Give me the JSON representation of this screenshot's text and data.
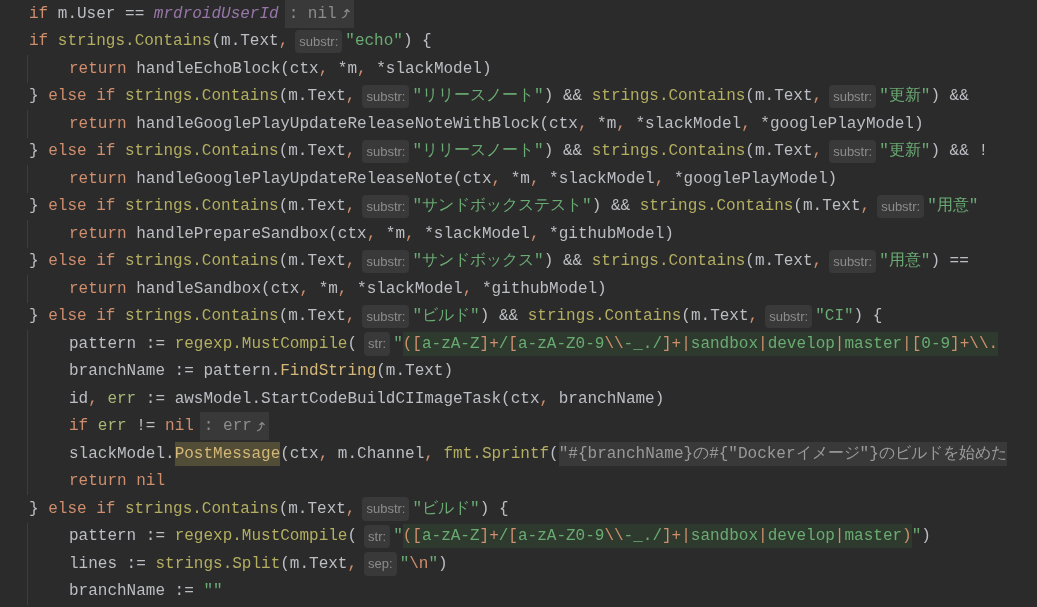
{
  "editor": {
    "lines": [
      {
        "indented": false,
        "tokens": [
          {
            "kind": "kw",
            "text": "if "
          },
          {
            "kind": "plain",
            "text": "m.User == "
          },
          {
            "kind": "const",
            "text": "mrdroidUserId"
          },
          {
            "kind": "endhint",
            "text": ": nil"
          }
        ]
      },
      {
        "indented": false,
        "tokens": [
          {
            "kind": "kw",
            "text": "if "
          },
          {
            "kind": "pkg",
            "text": "strings.Contains"
          },
          {
            "kind": "plain",
            "text": "(m.Text"
          },
          {
            "kind": "punct",
            "text": ","
          },
          {
            "kind": "hint",
            "text": "substr:"
          },
          {
            "kind": "str",
            "text": "\"echo\""
          },
          {
            "kind": "plain",
            "text": ") {"
          }
        ]
      },
      {
        "indented": true,
        "tokens": [
          {
            "kind": "kw",
            "text": "return "
          },
          {
            "kind": "plain",
            "text": "handleEchoBlock(ctx"
          },
          {
            "kind": "punct",
            "text": ", "
          },
          {
            "kind": "plain",
            "text": "*m"
          },
          {
            "kind": "punct",
            "text": ", "
          },
          {
            "kind": "plain",
            "text": "*slackModel)"
          }
        ]
      },
      {
        "indented": false,
        "tokens": [
          {
            "kind": "plain",
            "text": "} "
          },
          {
            "kind": "kw",
            "text": "else if "
          },
          {
            "kind": "pkg",
            "text": "strings.Contains"
          },
          {
            "kind": "plain",
            "text": "(m.Text"
          },
          {
            "kind": "punct",
            "text": ","
          },
          {
            "kind": "hint",
            "text": "substr:"
          },
          {
            "kind": "str",
            "text": "\"リリースノート\""
          },
          {
            "kind": "plain",
            "text": ") && "
          },
          {
            "kind": "pkg",
            "text": "strings.Contains"
          },
          {
            "kind": "plain",
            "text": "(m.Text"
          },
          {
            "kind": "punct",
            "text": ","
          },
          {
            "kind": "hint",
            "text": "substr:"
          },
          {
            "kind": "str",
            "text": "\"更新\""
          },
          {
            "kind": "plain",
            "text": ") &&"
          }
        ]
      },
      {
        "indented": true,
        "tokens": [
          {
            "kind": "kw",
            "text": "return "
          },
          {
            "kind": "plain",
            "text": "handleGooglePlayUpdateReleaseNoteWithBlock(ctx"
          },
          {
            "kind": "punct",
            "text": ", "
          },
          {
            "kind": "plain",
            "text": "*m"
          },
          {
            "kind": "punct",
            "text": ", "
          },
          {
            "kind": "plain",
            "text": "*slackModel"
          },
          {
            "kind": "punct",
            "text": ", "
          },
          {
            "kind": "plain",
            "text": "*googlePlayModel)"
          }
        ]
      },
      {
        "indented": false,
        "tokens": [
          {
            "kind": "plain",
            "text": "} "
          },
          {
            "kind": "kw",
            "text": "else if "
          },
          {
            "kind": "pkg",
            "text": "strings.Contains"
          },
          {
            "kind": "plain",
            "text": "(m.Text"
          },
          {
            "kind": "punct",
            "text": ","
          },
          {
            "kind": "hint",
            "text": "substr:"
          },
          {
            "kind": "str",
            "text": "\"リリースノート\""
          },
          {
            "kind": "plain",
            "text": ") && "
          },
          {
            "kind": "pkg",
            "text": "strings.Contains"
          },
          {
            "kind": "plain",
            "text": "(m.Text"
          },
          {
            "kind": "punct",
            "text": ","
          },
          {
            "kind": "hint",
            "text": "substr:"
          },
          {
            "kind": "str",
            "text": "\"更新\""
          },
          {
            "kind": "plain",
            "text": ") && !"
          }
        ]
      },
      {
        "indented": true,
        "tokens": [
          {
            "kind": "kw",
            "text": "return "
          },
          {
            "kind": "plain",
            "text": "handleGooglePlayUpdateReleaseNote(ctx"
          },
          {
            "kind": "punct",
            "text": ", "
          },
          {
            "kind": "plain",
            "text": "*m"
          },
          {
            "kind": "punct",
            "text": ", "
          },
          {
            "kind": "plain",
            "text": "*slackModel"
          },
          {
            "kind": "punct",
            "text": ", "
          },
          {
            "kind": "plain",
            "text": "*googlePlayModel)"
          }
        ]
      },
      {
        "indented": false,
        "tokens": [
          {
            "kind": "plain",
            "text": "} "
          },
          {
            "kind": "kw",
            "text": "else if "
          },
          {
            "kind": "pkg",
            "text": "strings.Contains"
          },
          {
            "kind": "plain",
            "text": "(m.Text"
          },
          {
            "kind": "punct",
            "text": ","
          },
          {
            "kind": "hint",
            "text": "substr:"
          },
          {
            "kind": "str",
            "text": "\"サンドボックステスト\""
          },
          {
            "kind": "plain",
            "text": ") && "
          },
          {
            "kind": "pkg",
            "text": "strings.Contains"
          },
          {
            "kind": "plain",
            "text": "(m.Text"
          },
          {
            "kind": "punct",
            "text": ","
          },
          {
            "kind": "hint",
            "text": "substr:"
          },
          {
            "kind": "str",
            "text": "\"用意\""
          }
        ]
      },
      {
        "indented": true,
        "tokens": [
          {
            "kind": "kw",
            "text": "return "
          },
          {
            "kind": "plain",
            "text": "handlePrepareSandbox(ctx"
          },
          {
            "kind": "punct",
            "text": ", "
          },
          {
            "kind": "plain",
            "text": "*m"
          },
          {
            "kind": "punct",
            "text": ", "
          },
          {
            "kind": "plain",
            "text": "*slackModel"
          },
          {
            "kind": "punct",
            "text": ", "
          },
          {
            "kind": "plain",
            "text": "*githubModel)"
          }
        ]
      },
      {
        "indented": false,
        "tokens": [
          {
            "kind": "plain",
            "text": "} "
          },
          {
            "kind": "kw",
            "text": "else if "
          },
          {
            "kind": "pkg",
            "text": "strings.Contains"
          },
          {
            "kind": "plain",
            "text": "(m.Text"
          },
          {
            "kind": "punct",
            "text": ","
          },
          {
            "kind": "hint",
            "text": "substr:"
          },
          {
            "kind": "str",
            "text": "\"サンドボックス\""
          },
          {
            "kind": "plain",
            "text": ") && "
          },
          {
            "kind": "pkg",
            "text": "strings.Contains"
          },
          {
            "kind": "plain",
            "text": "(m.Text"
          },
          {
            "kind": "punct",
            "text": ","
          },
          {
            "kind": "hint",
            "text": "substr:"
          },
          {
            "kind": "str",
            "text": "\"用意\""
          },
          {
            "kind": "plain",
            "text": ") =="
          }
        ]
      },
      {
        "indented": true,
        "tokens": [
          {
            "kind": "kw",
            "text": "return "
          },
          {
            "kind": "plain",
            "text": "handleSandbox(ctx"
          },
          {
            "kind": "punct",
            "text": ", "
          },
          {
            "kind": "plain",
            "text": "*m"
          },
          {
            "kind": "punct",
            "text": ", "
          },
          {
            "kind": "plain",
            "text": "*slackModel"
          },
          {
            "kind": "punct",
            "text": ", "
          },
          {
            "kind": "plain",
            "text": "*githubModel)"
          }
        ]
      },
      {
        "indented": false,
        "tokens": [
          {
            "kind": "plain",
            "text": "} "
          },
          {
            "kind": "kw",
            "text": "else if "
          },
          {
            "kind": "pkg",
            "text": "strings.Contains"
          },
          {
            "kind": "plain",
            "text": "(m.Text"
          },
          {
            "kind": "punct",
            "text": ","
          },
          {
            "kind": "hint",
            "text": "substr:"
          },
          {
            "kind": "str",
            "text": "\"ビルド\""
          },
          {
            "kind": "plain",
            "text": ") && "
          },
          {
            "kind": "pkg",
            "text": "strings.Contains"
          },
          {
            "kind": "plain",
            "text": "(m.Text"
          },
          {
            "kind": "punct",
            "text": ","
          },
          {
            "kind": "hint",
            "text": "substr:"
          },
          {
            "kind": "str",
            "text": "\"CI\""
          },
          {
            "kind": "plain",
            "text": ") {"
          }
        ]
      },
      {
        "indented": true,
        "tokens": [
          {
            "kind": "plain",
            "text": "pattern := "
          },
          {
            "kind": "pkg",
            "text": "regexp.MustCompile"
          },
          {
            "kind": "plain",
            "text": "("
          },
          {
            "kind": "hint",
            "text": "str:"
          },
          {
            "kind": "str",
            "text": "\""
          },
          {
            "kind": "rxop",
            "text": "(["
          },
          {
            "kind": "rx",
            "text": "a-zA-Z"
          },
          {
            "kind": "rxop",
            "text": "]+"
          },
          {
            "kind": "rx",
            "text": "/"
          },
          {
            "kind": "rxop",
            "text": "["
          },
          {
            "kind": "rx",
            "text": "a-zA-Z0-9"
          },
          {
            "kind": "rxop",
            "text": "\\\\"
          },
          {
            "kind": "rx",
            "text": "-_./"
          },
          {
            "kind": "rxop",
            "text": "]+|"
          },
          {
            "kind": "rx",
            "text": "sandbox"
          },
          {
            "kind": "rxop",
            "text": "|"
          },
          {
            "kind": "rx",
            "text": "develop"
          },
          {
            "kind": "rxop",
            "text": "|"
          },
          {
            "kind": "rx",
            "text": "master"
          },
          {
            "kind": "rxop",
            "text": "|["
          },
          {
            "kind": "rx",
            "text": "0-9"
          },
          {
            "kind": "rxop",
            "text": "]+\\\\."
          }
        ]
      },
      {
        "indented": true,
        "tokens": [
          {
            "kind": "plain",
            "text": "branchName := pattern."
          },
          {
            "kind": "fn",
            "text": "FindString"
          },
          {
            "kind": "plain",
            "text": "(m.Text)"
          }
        ]
      },
      {
        "indented": true,
        "tokens": [
          {
            "kind": "plain",
            "text": "id"
          },
          {
            "kind": "punct",
            "text": ", "
          },
          {
            "kind": "var",
            "text": "err"
          },
          {
            "kind": "plain",
            "text": " := awsModel.StartCodeBuildCIImageTask(ctx"
          },
          {
            "kind": "punct",
            "text": ", "
          },
          {
            "kind": "plain",
            "text": "branchName)"
          }
        ]
      },
      {
        "indented": true,
        "tokens": [
          {
            "kind": "kw",
            "text": "if "
          },
          {
            "kind": "var",
            "text": "err"
          },
          {
            "kind": "plain",
            "text": " != "
          },
          {
            "kind": "kw",
            "text": "nil"
          },
          {
            "kind": "endhint",
            "text": ": err"
          }
        ]
      },
      {
        "indented": true,
        "tokens": [
          {
            "kind": "plain",
            "text": "slackModel."
          },
          {
            "kind": "hl",
            "text": "PostMessage"
          },
          {
            "kind": "plain",
            "text": "(ctx"
          },
          {
            "kind": "punct",
            "text": ", "
          },
          {
            "kind": "plain",
            "text": "m.Channel"
          },
          {
            "kind": "punct",
            "text": ", "
          },
          {
            "kind": "pkg",
            "text": "fmt.Sprintf"
          },
          {
            "kind": "plain",
            "text": "("
          },
          {
            "kind": "tmpl",
            "text": "\"#{branchName}の#{\"Dockerイメージ\"}のビルドを始めた"
          }
        ]
      },
      {
        "indented": true,
        "tokens": [
          {
            "kind": "kw",
            "text": "return nil"
          }
        ]
      },
      {
        "indented": false,
        "tokens": [
          {
            "kind": "plain",
            "text": "} "
          },
          {
            "kind": "kw",
            "text": "else if "
          },
          {
            "kind": "pkg",
            "text": "strings.Contains"
          },
          {
            "kind": "plain",
            "text": "(m.Text"
          },
          {
            "kind": "punct",
            "text": ","
          },
          {
            "kind": "hint",
            "text": "substr:"
          },
          {
            "kind": "str",
            "text": "\"ビルド\""
          },
          {
            "kind": "plain",
            "text": ") {"
          }
        ]
      },
      {
        "indented": true,
        "tokens": [
          {
            "kind": "plain",
            "text": "pattern := "
          },
          {
            "kind": "pkg",
            "text": "regexp.MustCompile"
          },
          {
            "kind": "plain",
            "text": "("
          },
          {
            "kind": "hint",
            "text": "str:"
          },
          {
            "kind": "str",
            "text": "\""
          },
          {
            "kind": "rxop",
            "text": "(["
          },
          {
            "kind": "rx",
            "text": "a-zA-Z"
          },
          {
            "kind": "rxop",
            "text": "]+"
          },
          {
            "kind": "rx",
            "text": "/"
          },
          {
            "kind": "rxop",
            "text": "["
          },
          {
            "kind": "rx",
            "text": "a-zA-Z0-9"
          },
          {
            "kind": "rxop",
            "text": "\\\\"
          },
          {
            "kind": "rx",
            "text": "-_./"
          },
          {
            "kind": "rxop",
            "text": "]+|"
          },
          {
            "kind": "rx",
            "text": "sandbox"
          },
          {
            "kind": "rxop",
            "text": "|"
          },
          {
            "kind": "rx",
            "text": "develop"
          },
          {
            "kind": "rxop",
            "text": "|"
          },
          {
            "kind": "rx",
            "text": "master"
          },
          {
            "kind": "rxop",
            "text": ")"
          },
          {
            "kind": "str",
            "text": "\""
          },
          {
            "kind": "plain",
            "text": ")"
          }
        ]
      },
      {
        "indented": true,
        "tokens": [
          {
            "kind": "plain",
            "text": "lines := "
          },
          {
            "kind": "pkg",
            "text": "strings.Split"
          },
          {
            "kind": "plain",
            "text": "(m.Text"
          },
          {
            "kind": "punct",
            "text": ","
          },
          {
            "kind": "hint",
            "text": "sep:"
          },
          {
            "kind": "str",
            "text": "\""
          },
          {
            "kind": "esc",
            "text": "\\n"
          },
          {
            "kind": "str",
            "text": "\""
          },
          {
            "kind": "plain",
            "text": ")"
          }
        ]
      },
      {
        "indented": true,
        "tokens": [
          {
            "kind": "plain",
            "text": "branchName := "
          },
          {
            "kind": "str",
            "text": "\"\""
          }
        ]
      }
    ]
  }
}
